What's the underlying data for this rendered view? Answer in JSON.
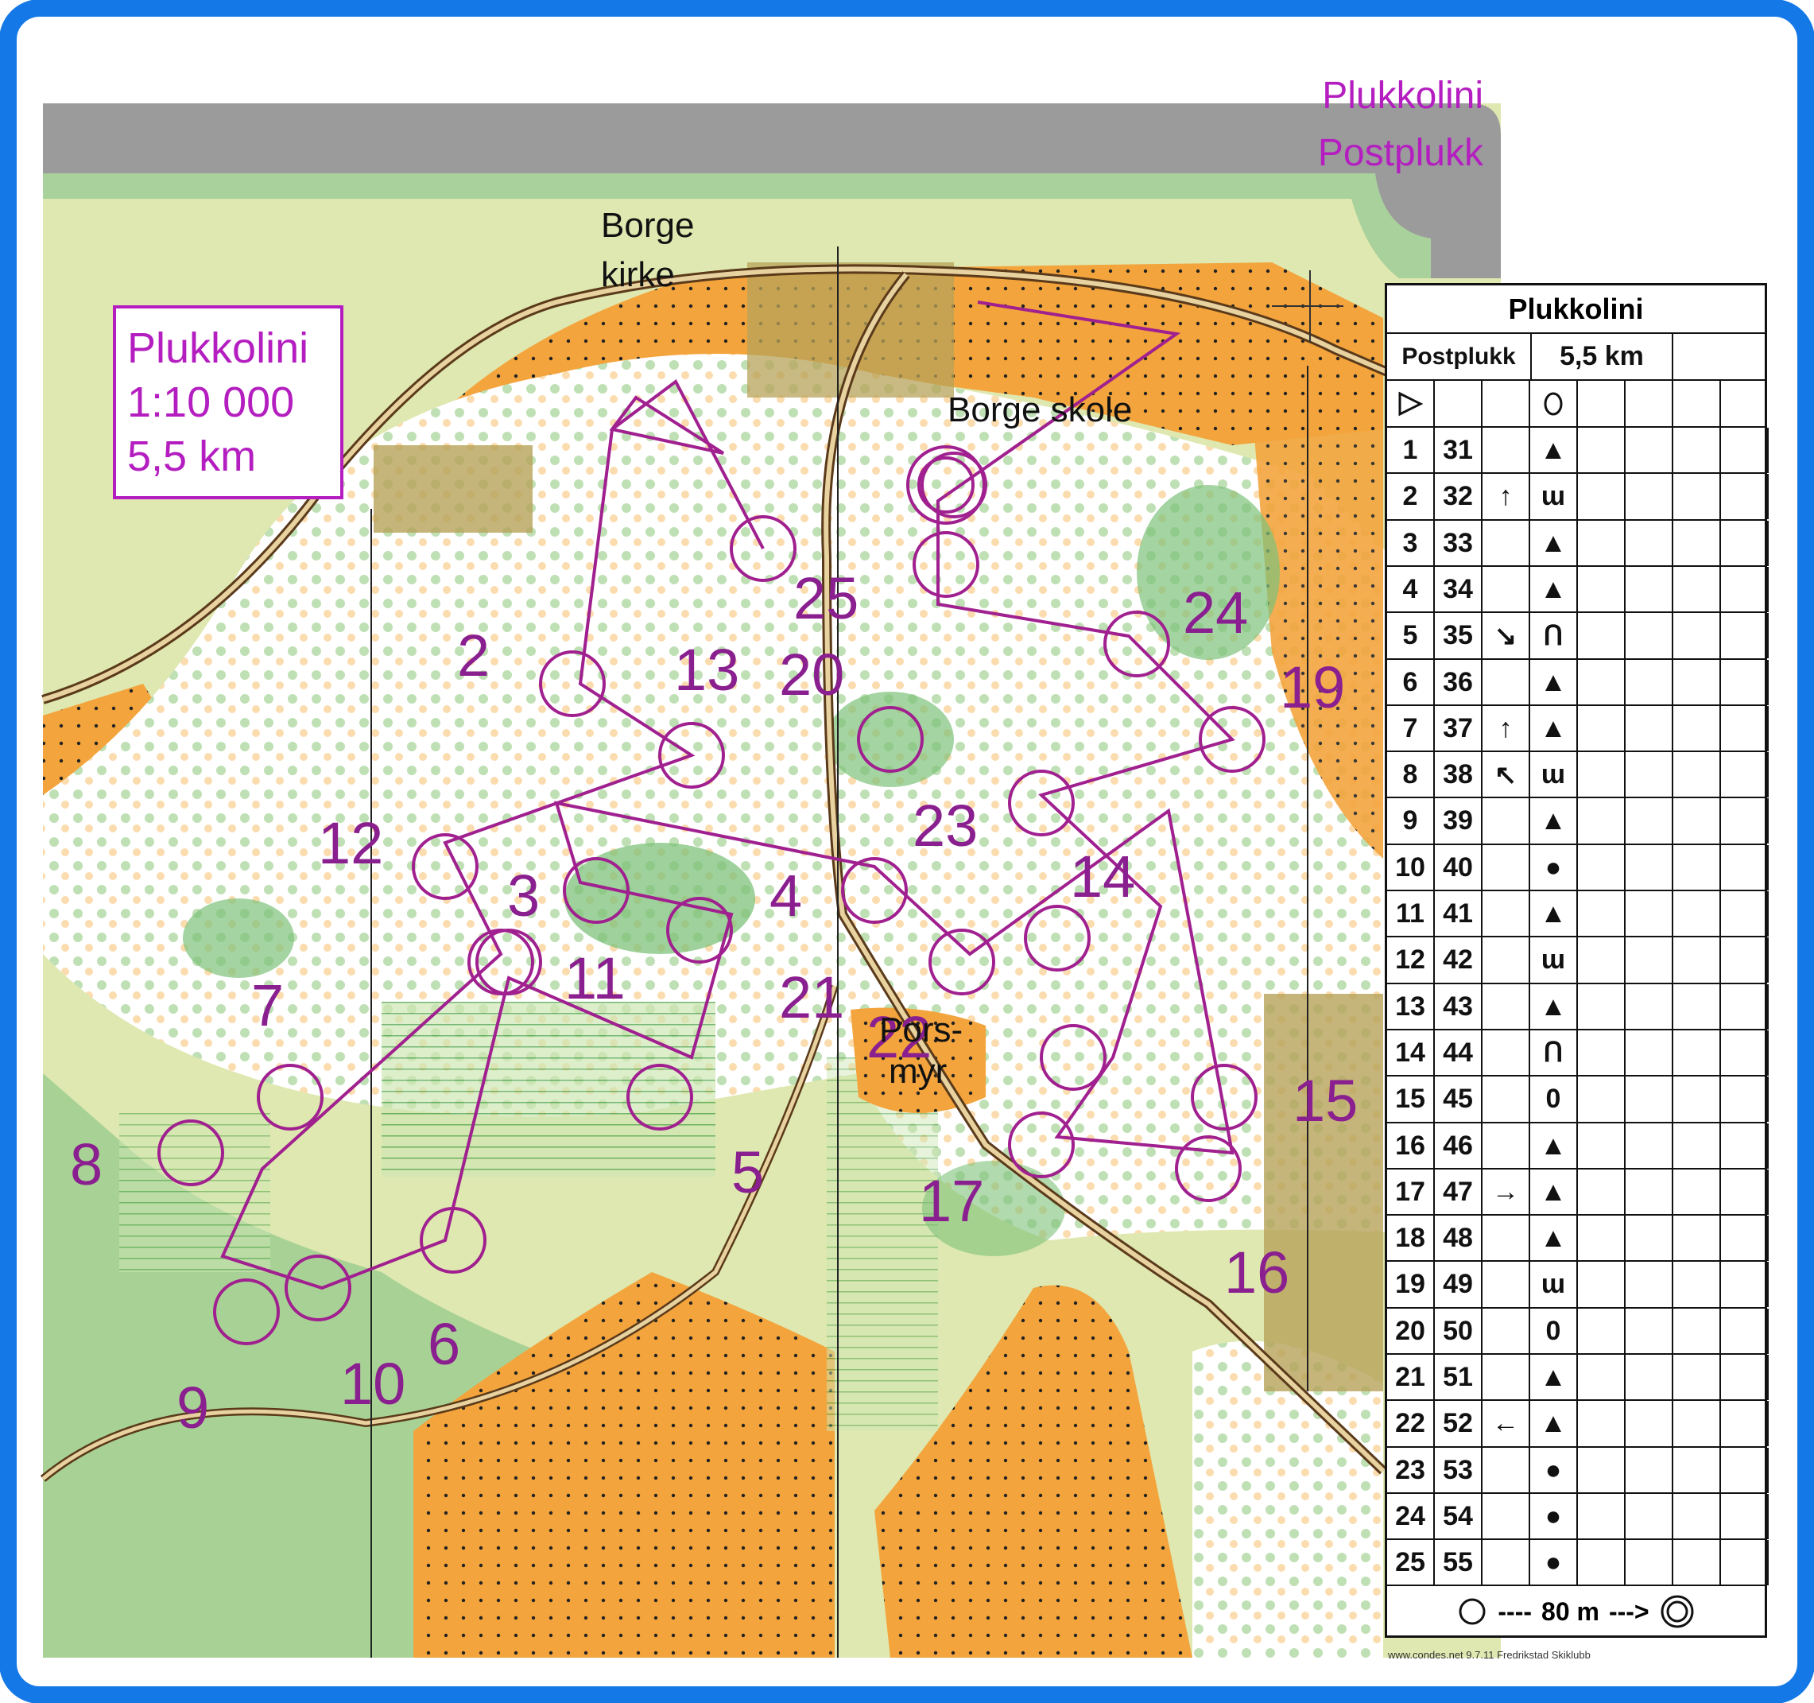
{
  "map": {
    "title_lines": [
      "Plukkolini",
      "Postplukk"
    ],
    "info_box": [
      "Plukkolini",
      "1:10 000",
      "5,5 km"
    ],
    "places": [
      "Borge",
      "kirke",
      "Borge skole",
      "Pors-",
      "myr"
    ],
    "controls": [
      {
        "n": "2"
      },
      {
        "n": "3"
      },
      {
        "n": "4"
      },
      {
        "n": "5"
      },
      {
        "n": "6"
      },
      {
        "n": "7"
      },
      {
        "n": "8"
      },
      {
        "n": "9"
      },
      {
        "n": "10"
      },
      {
        "n": "11"
      },
      {
        "n": "12"
      },
      {
        "n": "13"
      },
      {
        "n": "14"
      },
      {
        "n": "15"
      },
      {
        "n": "16"
      },
      {
        "n": "17"
      },
      {
        "n": "19"
      },
      {
        "n": "20"
      },
      {
        "n": "21"
      },
      {
        "n": "22"
      },
      {
        "n": "23"
      },
      {
        "n": "24"
      },
      {
        "n": "25"
      }
    ],
    "colors": {
      "course": "#a0208f",
      "open_land": "#f3a43c",
      "forest_green": "#7ec27a",
      "light_green": "#dfe8b0",
      "road": "#888888",
      "frame": "#1478e6"
    }
  },
  "descriptions": {
    "title": "Plukkolini",
    "course": "Postplukk",
    "length": "5,5 km",
    "start_symbol": "triangle-start-icon",
    "start_feature": "oval",
    "rows": [
      {
        "num": "1",
        "code": "31",
        "dir": "",
        "feature": "▲"
      },
      {
        "num": "2",
        "code": "32",
        "dir": "↑",
        "feature": "ɯ"
      },
      {
        "num": "3",
        "code": "33",
        "dir": "",
        "feature": "▲"
      },
      {
        "num": "4",
        "code": "34",
        "dir": "",
        "feature": "▲"
      },
      {
        "num": "5",
        "code": "35",
        "dir": "↘",
        "feature": "Ո"
      },
      {
        "num": "6",
        "code": "36",
        "dir": "",
        "feature": "▲"
      },
      {
        "num": "7",
        "code": "37",
        "dir": "↑",
        "feature": "▲"
      },
      {
        "num": "8",
        "code": "38",
        "dir": "↖",
        "feature": "ɯ"
      },
      {
        "num": "9",
        "code": "39",
        "dir": "",
        "feature": "▲"
      },
      {
        "num": "10",
        "code": "40",
        "dir": "",
        "feature": "●"
      },
      {
        "num": "11",
        "code": "41",
        "dir": "",
        "feature": "▲"
      },
      {
        "num": "12",
        "code": "42",
        "dir": "",
        "feature": "ɯ"
      },
      {
        "num": "13",
        "code": "43",
        "dir": "",
        "feature": "▲"
      },
      {
        "num": "14",
        "code": "44",
        "dir": "",
        "feature": "Ո"
      },
      {
        "num": "15",
        "code": "45",
        "dir": "",
        "feature": "0"
      },
      {
        "num": "16",
        "code": "46",
        "dir": "",
        "feature": "▲"
      },
      {
        "num": "17",
        "code": "47",
        "dir": "→",
        "feature": "▲"
      },
      {
        "num": "18",
        "code": "48",
        "dir": "",
        "feature": "▲"
      },
      {
        "num": "19",
        "code": "49",
        "dir": "",
        "feature": "ɯ"
      },
      {
        "num": "20",
        "code": "50",
        "dir": "",
        "feature": "0"
      },
      {
        "num": "21",
        "code": "51",
        "dir": "",
        "feature": "▲"
      },
      {
        "num": "22",
        "code": "52",
        "dir": "←",
        "feature": "▲"
      },
      {
        "num": "23",
        "code": "53",
        "dir": "",
        "feature": "●"
      },
      {
        "num": "24",
        "code": "54",
        "dir": "",
        "feature": "●"
      },
      {
        "num": "25",
        "code": "55",
        "dir": "",
        "feature": "●"
      }
    ],
    "finish_text": "80 m",
    "footer": "www.condes.net 9.7.11 Fredrikstad Skiklubb"
  }
}
